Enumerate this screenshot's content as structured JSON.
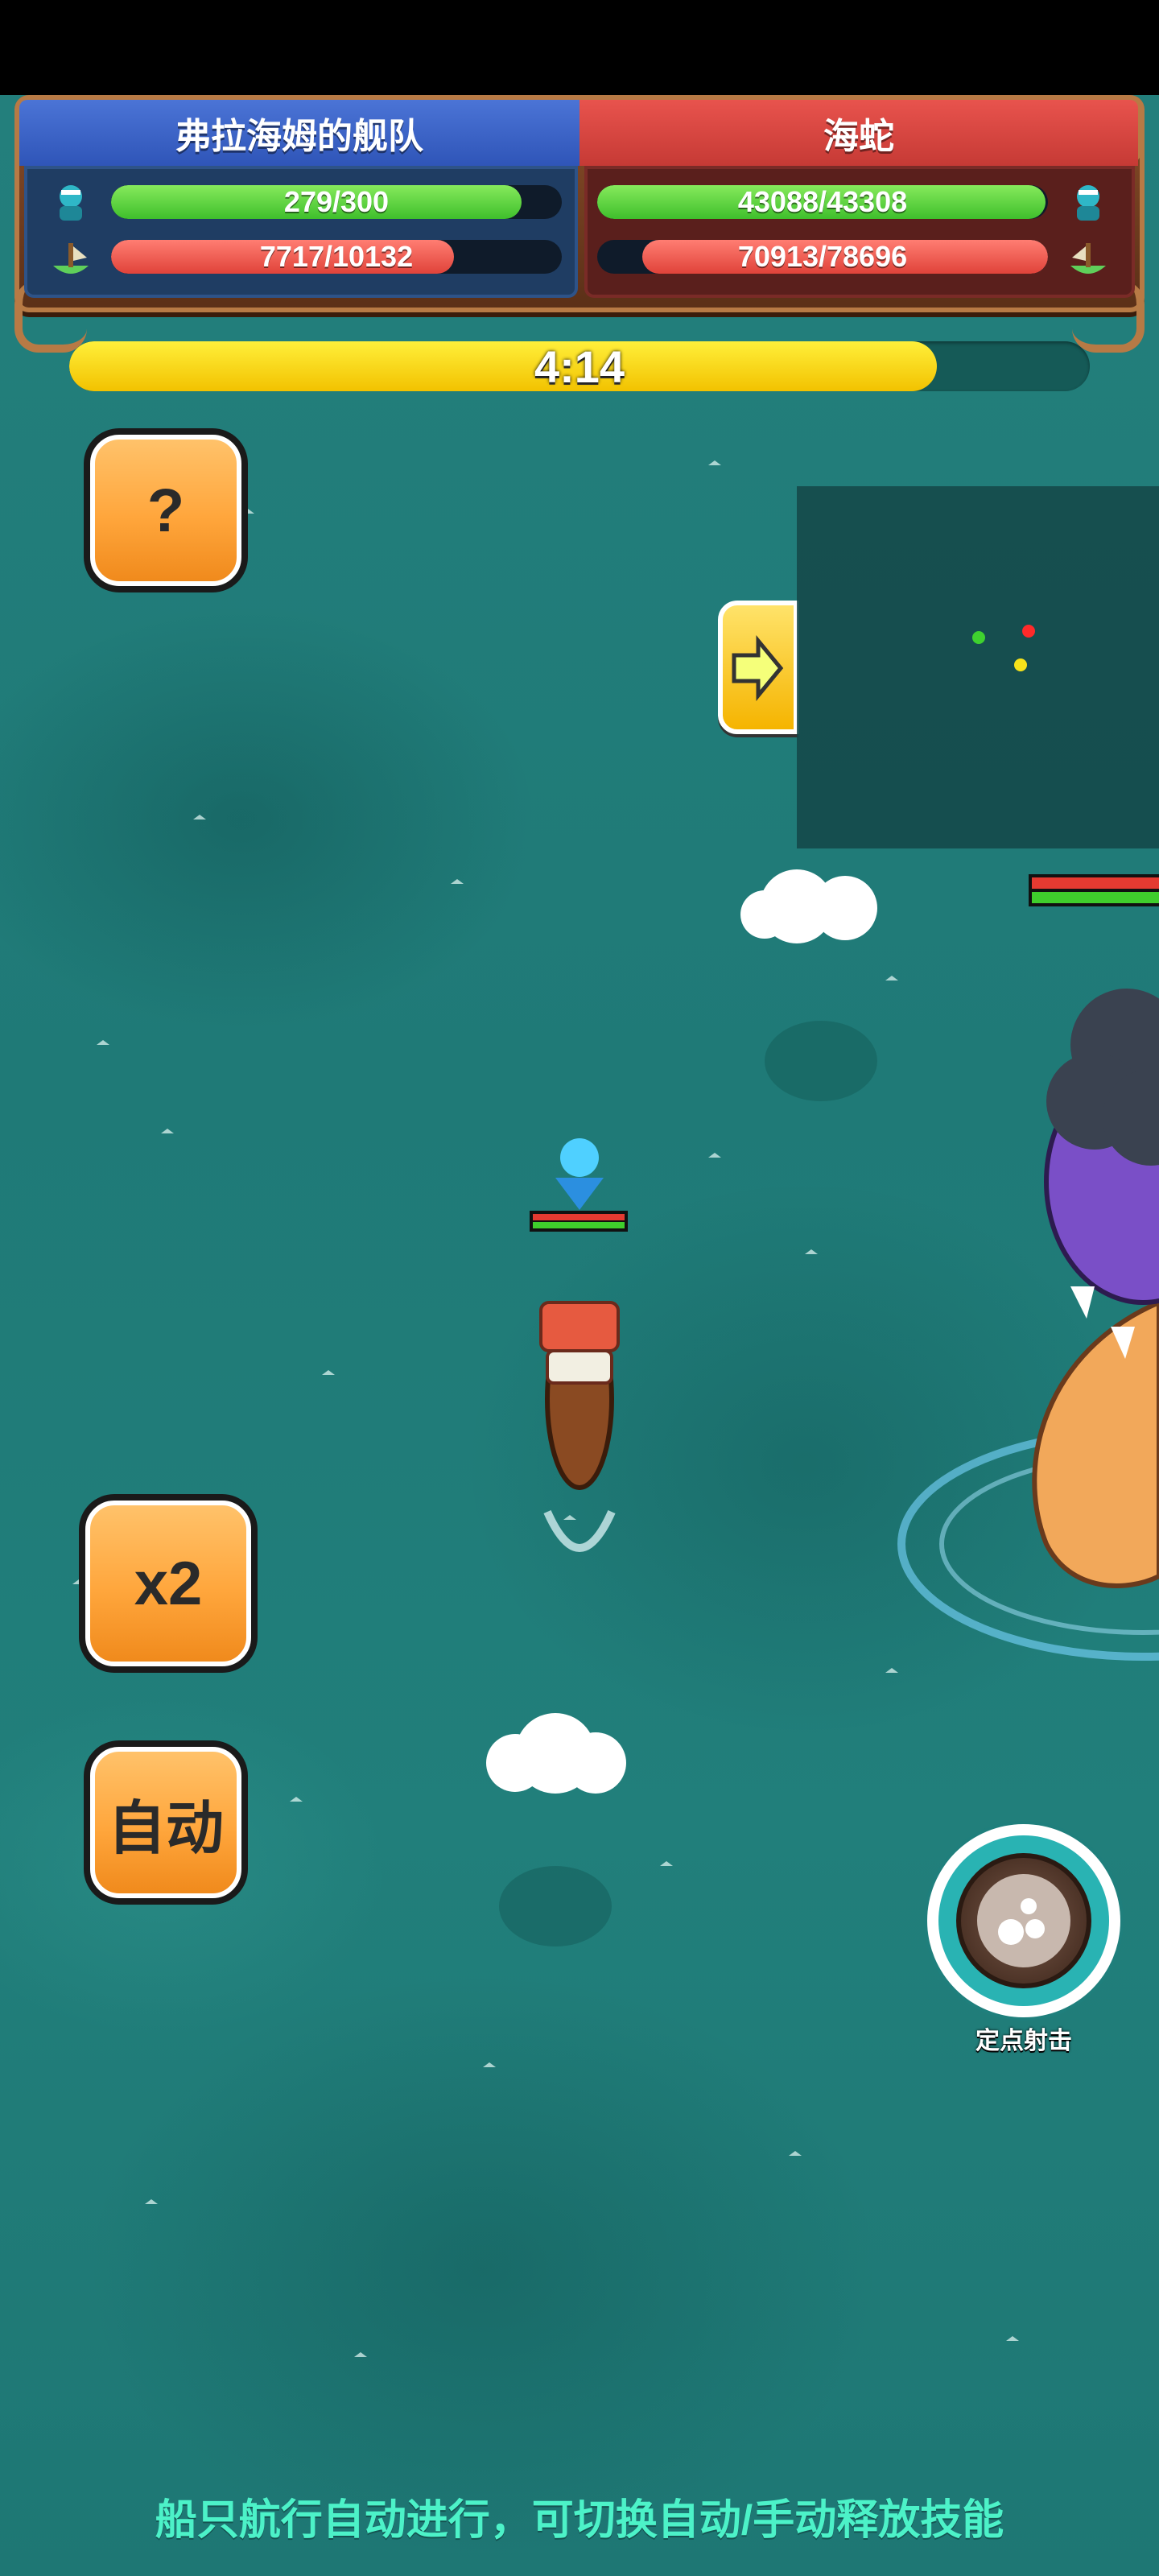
{
  "teams": {
    "left": {
      "name": "弗拉海姆的舰队",
      "crew": {
        "text": "279/300",
        "current": 279,
        "max": 300
      },
      "hull": {
        "text": "7717/10132",
        "current": 7717,
        "max": 10132
      }
    },
    "right": {
      "name": "海蛇",
      "crew": {
        "text": "43088/43308",
        "current": 43088,
        "max": 43308
      },
      "hull": {
        "text": "70913/78696",
        "current": 70913,
        "max": 78696
      }
    }
  },
  "timer": {
    "text": "4:14",
    "fraction": 0.85
  },
  "buttons": {
    "help": "?",
    "speed": "x2",
    "auto": "自动"
  },
  "skill": {
    "label": "定点射击"
  },
  "tip": "船只航行自动进行，可切换自动/手动释放技能",
  "colors": {
    "ally": "#3f66c9",
    "enemy": "#d9463f",
    "ocean": "#1f7f7c",
    "tip": "#4cf2c8"
  },
  "icons": [
    "crew-icon",
    "ship-icon",
    "question-icon",
    "arrow-right-icon",
    "cannon-skill-icon"
  ]
}
